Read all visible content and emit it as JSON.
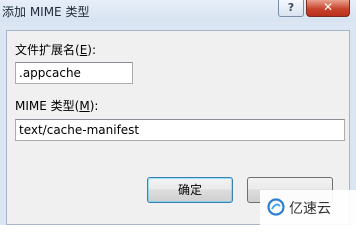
{
  "window": {
    "title": "添加 MIME 类型",
    "help_glyph": "?",
    "close_glyph": "✕"
  },
  "extension": {
    "label_prefix": "文件扩展名(",
    "label_hotkey": "E",
    "label_suffix": "):",
    "value": ".appcache"
  },
  "mime": {
    "label_prefix": "MIME 类型(",
    "label_hotkey": "M",
    "label_suffix": "):",
    "value": "text/cache-manifest"
  },
  "buttons": {
    "ok_label": "确定"
  },
  "watermark": {
    "text": "亿速云",
    "logo_icon": "yisu-logo-icon"
  }
}
